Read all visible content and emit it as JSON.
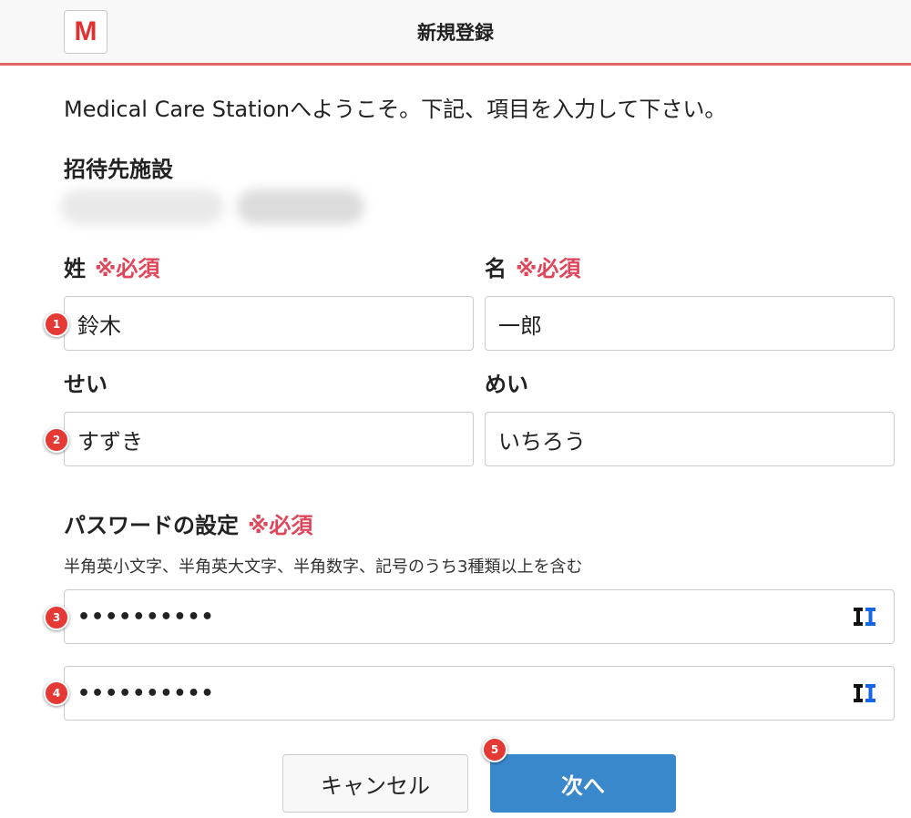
{
  "header": {
    "logo_letter": "M",
    "title": "新規登録"
  },
  "welcome_text": "Medical Care Stationへようこそ。下記、項目を入力して下さい。",
  "facility": {
    "label": "招待先施設"
  },
  "required_mark": "※必須",
  "last_name": {
    "label": "姓",
    "value": "鈴木"
  },
  "first_name": {
    "label": "名",
    "value": "一郎"
  },
  "last_name_kana": {
    "label": "せい",
    "value": "すずき"
  },
  "first_name_kana": {
    "label": "めい",
    "value": "いちろう"
  },
  "password": {
    "label": "パスワードの設定",
    "hint": "半角英小文字、半角英大文字、半角数字、記号のうち3種類以上を含む",
    "value_masked": "••••••••••",
    "confirm_masked": "••••••••••",
    "toggle_icon": "password-manager-icon"
  },
  "buttons": {
    "cancel": "キャンセル",
    "next": "次へ"
  },
  "annotations": [
    "1",
    "2",
    "3",
    "4",
    "5"
  ],
  "colors": {
    "accent_red": "#e0465a",
    "header_border": "#e06666",
    "primary_button": "#3a88cc",
    "badge": "#e53935",
    "logo": "#e03131"
  }
}
